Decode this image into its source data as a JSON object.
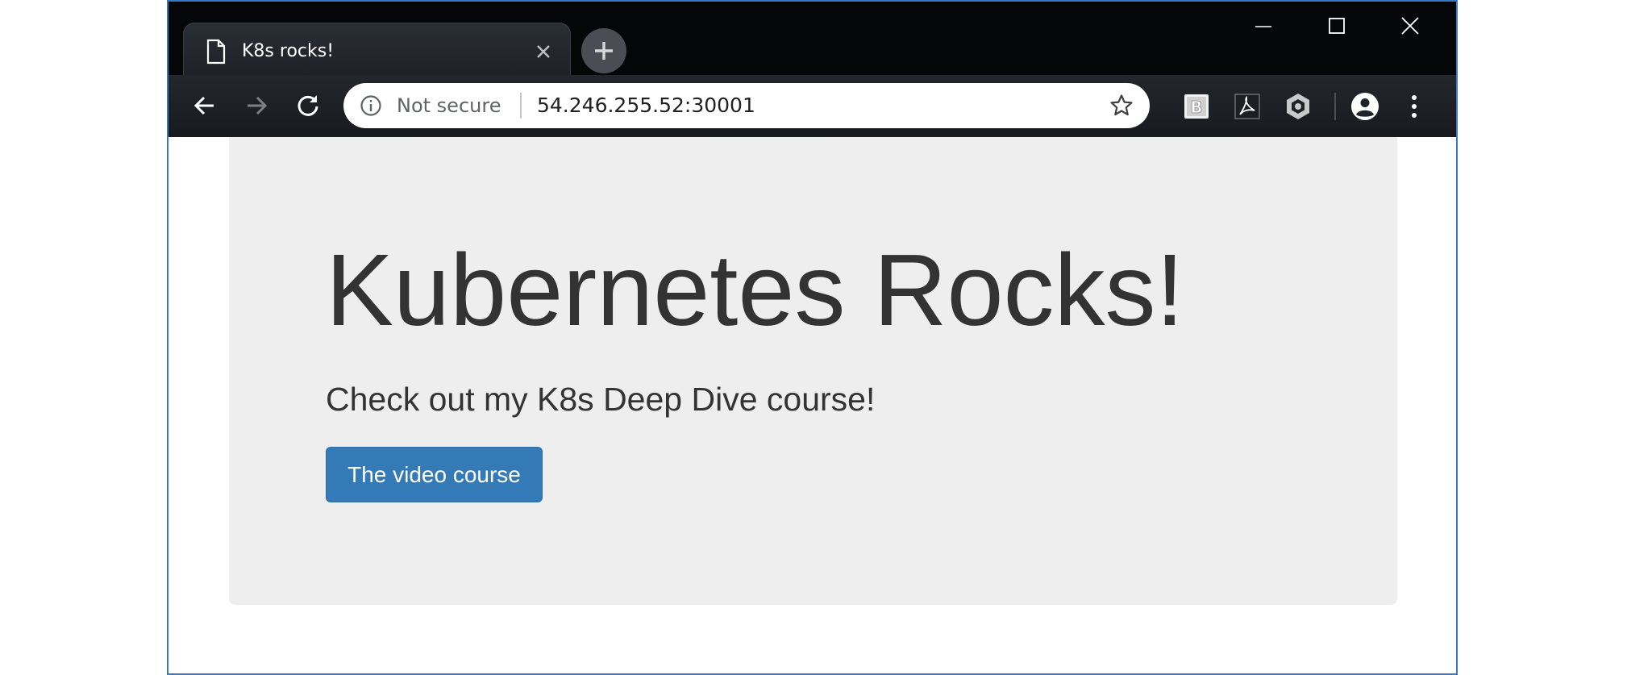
{
  "browser": {
    "tab": {
      "title": "K8s rocks!",
      "icon": "page-icon"
    },
    "omnibox": {
      "security_label": "Not secure",
      "url": "54.246.255.52:30001"
    },
    "extensions": [
      "bootstrap-extension-icon",
      "pdf-extension-icon",
      "hexagon-extension-icon"
    ]
  },
  "page": {
    "heading": "Kubernetes Rocks!",
    "lead": "Check out my K8s Deep Dive course!",
    "button_label": "The video course"
  },
  "colors": {
    "titlebar": "#050608",
    "toolbar": "#1f2227",
    "jumbotron_bg": "#eeeeee",
    "button_bg": "#337ab7",
    "window_border": "#3b78c4"
  }
}
